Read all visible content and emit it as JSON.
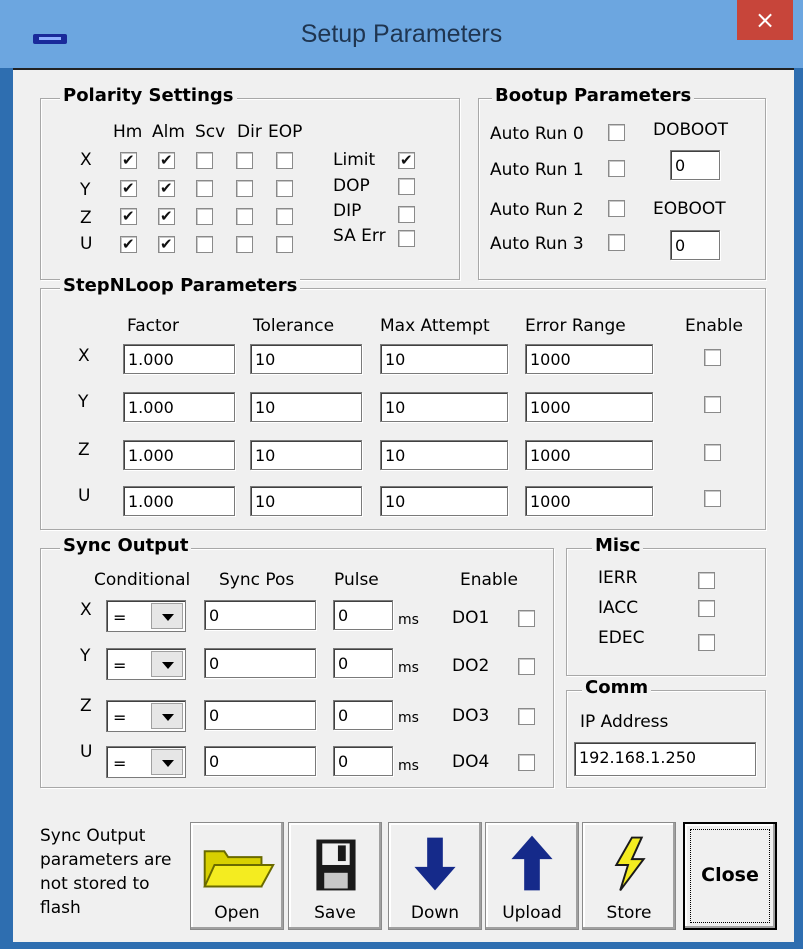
{
  "window": {
    "title": "Setup Parameters",
    "close_glyph": "×",
    "accent": "#6ca6e0",
    "close_color": "#c7453a"
  },
  "polarity": {
    "title": "Polarity Settings",
    "headers": [
      "Hm",
      "Alm",
      "Scv",
      "Dir",
      "EOP"
    ],
    "axes": [
      "X",
      "Y",
      "Z",
      "U"
    ],
    "rows": [
      [
        true,
        true,
        false,
        false,
        false
      ],
      [
        true,
        true,
        false,
        false,
        false
      ],
      [
        true,
        true,
        false,
        false,
        false
      ],
      [
        true,
        true,
        false,
        false,
        false
      ]
    ],
    "extras": [
      {
        "label": "Limit",
        "checked": true
      },
      {
        "label": "DOP",
        "checked": false
      },
      {
        "label": "DIP",
        "checked": false
      },
      {
        "label": "SA Err",
        "checked": false
      }
    ]
  },
  "bootup": {
    "title": "Bootup Parameters",
    "autoruns": [
      "Auto Run 0",
      "Auto Run 1",
      "Auto Run 2",
      "Auto Run 3"
    ],
    "doboot_label": "DOBOOT",
    "doboot_value": "0",
    "eoboot_label": "EOBOOT",
    "eoboot_value": "0"
  },
  "stepnloop": {
    "title": "StepNLoop Parameters",
    "headers": {
      "factor": "Factor",
      "tolerance": "Tolerance",
      "max_attempt": "Max Attempt",
      "error_range": "Error Range",
      "enable": "Enable"
    },
    "rows": [
      {
        "axis": "X",
        "factor": "1.000",
        "tolerance": "10",
        "max_attempt": "10",
        "error_range": "1000",
        "enable": false
      },
      {
        "axis": "Y",
        "factor": "1.000",
        "tolerance": "10",
        "max_attempt": "10",
        "error_range": "1000",
        "enable": false
      },
      {
        "axis": "Z",
        "factor": "1.000",
        "tolerance": "10",
        "max_attempt": "10",
        "error_range": "1000",
        "enable": false
      },
      {
        "axis": "U",
        "factor": "1.000",
        "tolerance": "10",
        "max_attempt": "10",
        "error_range": "1000",
        "enable": false
      }
    ]
  },
  "sync": {
    "title": "Sync Output",
    "headers": {
      "conditional": "Conditional",
      "sync_pos": "Sync Pos",
      "pulse": "Pulse",
      "enable": "Enable"
    },
    "unit": "ms",
    "rows": [
      {
        "axis": "X",
        "conditional": "=",
        "sync_pos": "0",
        "pulse": "0",
        "output": "DO1",
        "enable": false
      },
      {
        "axis": "Y",
        "conditional": "=",
        "sync_pos": "0",
        "pulse": "0",
        "output": "DO2",
        "enable": false
      },
      {
        "axis": "Z",
        "conditional": "=",
        "sync_pos": "0",
        "pulse": "0",
        "output": "DO3",
        "enable": false
      },
      {
        "axis": "U",
        "conditional": "=",
        "sync_pos": "0",
        "pulse": "0",
        "output": "DO4",
        "enable": false
      }
    ]
  },
  "misc": {
    "title": "Misc",
    "items": [
      {
        "label": "IERR",
        "checked": false
      },
      {
        "label": "IACC",
        "checked": false
      },
      {
        "label": "EDEC",
        "checked": false
      }
    ]
  },
  "comm": {
    "title": "Comm",
    "ip_label": "IP Address",
    "ip_value": "192.168.1.250"
  },
  "footer": {
    "note_lines": [
      "Sync Output",
      "parameters are",
      "not stored to",
      "flash"
    ],
    "buttons": {
      "open": "Open",
      "save": "Save",
      "down": "Down",
      "upload": "Upload",
      "store": "Store",
      "close": "Close"
    }
  },
  "icons": [
    "app-icon",
    "close-icon",
    "folder-icon",
    "floppy-disk-icon",
    "down-arrow-icon",
    "up-arrow-icon",
    "lightning-icon"
  ]
}
